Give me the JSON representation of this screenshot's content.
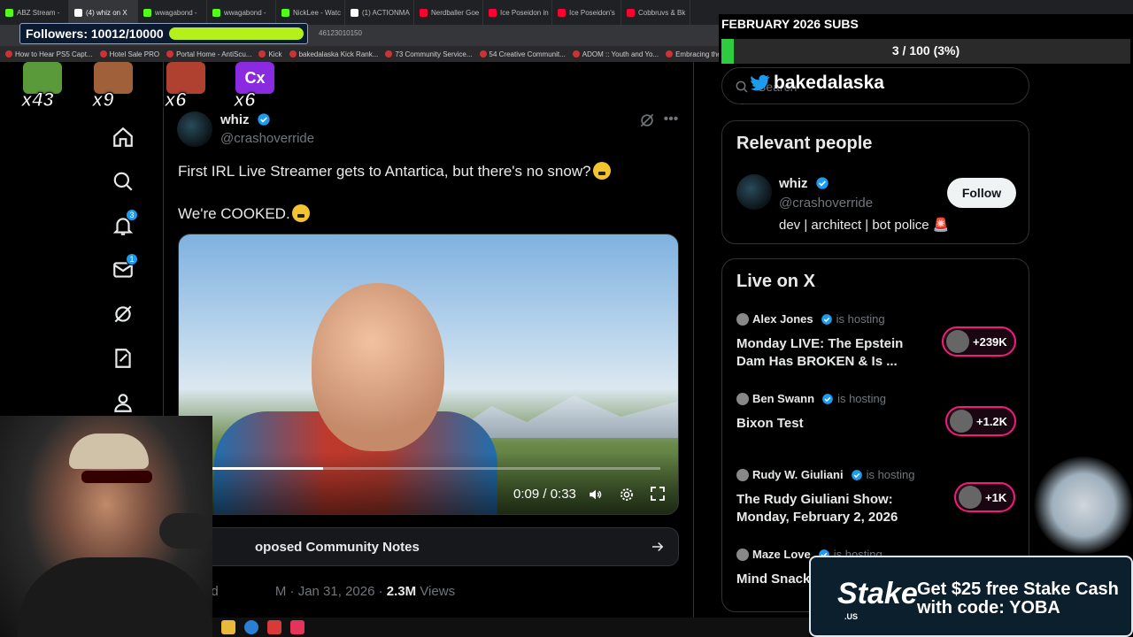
{
  "browser": {
    "tabs": [
      {
        "label": "ABZ Stream -",
        "color": "#53fc18"
      },
      {
        "label": "(4) whiz on X",
        "color": "#ffffff"
      },
      {
        "label": "wwagabond -",
        "color": "#53fc18"
      },
      {
        "label": "wwagabond -",
        "color": "#53fc18"
      },
      {
        "label": "NickLee - Watc",
        "color": "#53fc18"
      },
      {
        "label": "(1) ACTIONMA",
        "color": "#ffffff"
      },
      {
        "label": "Nerdballer Goe",
        "color": "#ff0033"
      },
      {
        "label": "Ice Poseidon in",
        "color": "#ff0033"
      },
      {
        "label": "Ice Poseidon's",
        "color": "#ff0033"
      },
      {
        "label": "Cobbruvs & Bk",
        "color": "#ff0033"
      }
    ],
    "address_fragment": "46123010150",
    "bookmarks": [
      "How to Hear PS5 Capt...",
      "Hotel Sale PRO",
      "Portal Home - AntiScu...",
      "Kick",
      "bakedalaska Kick Rank...",
      "73 Community Service...",
      "54 Creative Communit...",
      "ADOM :: Youth and Yo...",
      "Embracing the Cross a..."
    ]
  },
  "nav": {
    "notifications_badge": "3",
    "messages_badge": "1"
  },
  "tweet": {
    "author_name": "whiz",
    "author_handle": "@crashoverride",
    "text_line1": "First IRL Live Streamer gets to Antartica, but there's no snow?",
    "text_line2": "We're COOKED.",
    "video_time": "0:09 / 0:33",
    "video_progress": 0.27,
    "community_notes": "oposed Community Notes",
    "meta_prefix": "ed",
    "meta_time_fragment": "M",
    "date": "Jan 31, 2026",
    "views_count": "2.3M",
    "views_label": "Views"
  },
  "sidebar": {
    "search_placeholder": "Search",
    "relevant_people_title": "Relevant people",
    "relevant_person": {
      "name": "whiz",
      "handle": "@crashoverride",
      "bio": "dev | architect | bot police 🚨",
      "follow_label": "Follow"
    },
    "live_title": "Live on X",
    "live_items": [
      {
        "host": "Alex Jones",
        "hosting": "is hosting",
        "title": "Monday LIVE: The Epstein Dam Has BROKEN & Is ...",
        "listeners": "+239K"
      },
      {
        "host": "Ben Swann",
        "hosting": "is hosting",
        "title": "Bixon Test",
        "listeners": "+1.2K"
      },
      {
        "host": "Rudy W. Giuliani",
        "hosting": "is hosting",
        "title": "The Rudy Giuliani Show: Monday, February 2, 2026",
        "listeners": "+1K"
      },
      {
        "host": "Maze Love",
        "hosting": "is hosting",
        "title": "Mind Snack Cognitive W",
        "listeners": ""
      }
    ]
  },
  "overlays": {
    "followers_text": "Followers: 10012/10000",
    "followers_progress": 1.0,
    "subs_title": "FEBRUARY 2026 SUBS",
    "subs_text": "3 / 100 (3%)",
    "subs_progress": 0.03,
    "brand_handle": "bakedalaska",
    "emotes": [
      {
        "mult": "x43",
        "color": "#5a9a3a"
      },
      {
        "mult": "x9",
        "color": "#a0603a"
      },
      {
        "mult": "x6",
        "color": "#b04030"
      },
      {
        "mult": "x6",
        "label": "Cx",
        "color": "#8a2be2"
      }
    ],
    "stake": {
      "logo": "Stake",
      "logo_sub": ".US",
      "promo": "Get $25 free Stake Cash with code: YOBA"
    }
  },
  "colors": {
    "accent_blue": "#1d9bf0",
    "live_pink": "#f91880",
    "followers_green": "#b5f01a",
    "subs_green": "#2ecc40"
  }
}
